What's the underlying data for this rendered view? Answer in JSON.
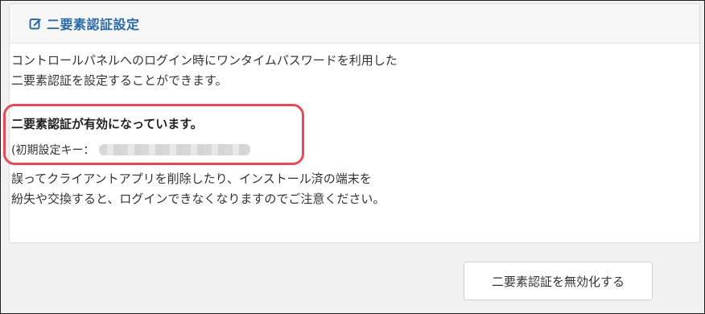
{
  "panel": {
    "title": "二要素認証設定",
    "title_icon": "edit-icon",
    "intro_line1": "コントロールパネルへのログイン時にワンタイムパスワードを利用した",
    "intro_line2": "二要素認証を設定することができます。",
    "status_text": "二要素認証が有効になっています。",
    "key_label": "(初期設定キー：",
    "key_value_state": "blurred",
    "warning_line1": "誤ってクライアントアプリを削除したり、インストール済の端末を",
    "warning_line2": "紛失や交換すると、ログインできなくなりますのでご注意ください。"
  },
  "footer": {
    "disable_button_label": "二要素認証を無効化する"
  },
  "colors": {
    "title": "#2b6aa8",
    "highlight_border": "#e14b5a"
  }
}
